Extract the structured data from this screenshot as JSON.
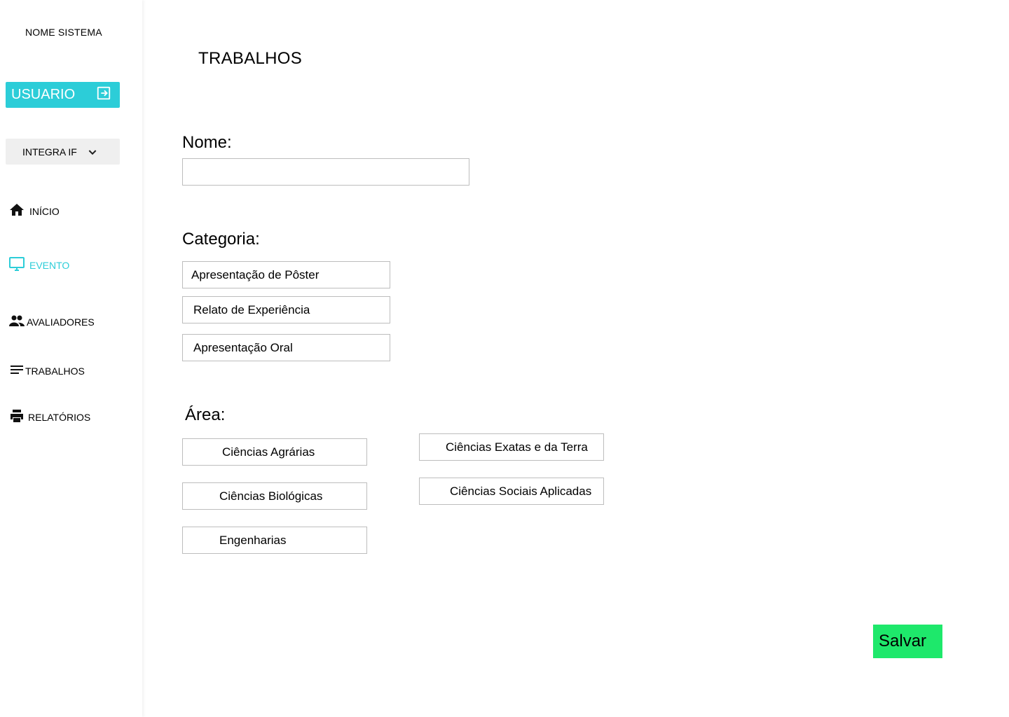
{
  "colors": {
    "accent": "#2ccdd8",
    "save": "#1ee86b",
    "select_bg": "#efefef",
    "border": "#bdbdbd"
  },
  "sidebar": {
    "system_name": "NOME SISTEMA",
    "user_button": {
      "label": "USUARIO",
      "icon": "logout-icon"
    },
    "event_select": {
      "value": "INTEGRA IF",
      "icon": "chevron-down-icon"
    },
    "items": [
      {
        "label": "INÍCIO",
        "icon": "home-icon",
        "active": false
      },
      {
        "label": "EVENTO",
        "icon": "monitor-icon",
        "active": true
      },
      {
        "label": "AVALIADORES",
        "icon": "people-icon",
        "active": false
      },
      {
        "label": "TRABALHOS",
        "icon": "list-icon",
        "active": false
      },
      {
        "label": "RELATÓRIOS",
        "icon": "printer-icon",
        "active": false
      }
    ]
  },
  "main": {
    "title": "TRABALHOS",
    "name_label": "Nome:",
    "name_value": "",
    "category_label": "Categoria:",
    "categories": [
      "Apresentação de Pôster",
      "Relato de Experiência",
      "Apresentação Oral"
    ],
    "area_label": "Área:",
    "areas": [
      "Ciências Agrárias",
      "Ciências Biológicas",
      "Engenharias",
      "Ciências Exatas e da Terra",
      "Ciências Sociais Aplicadas"
    ],
    "save_label": "Salvar"
  }
}
